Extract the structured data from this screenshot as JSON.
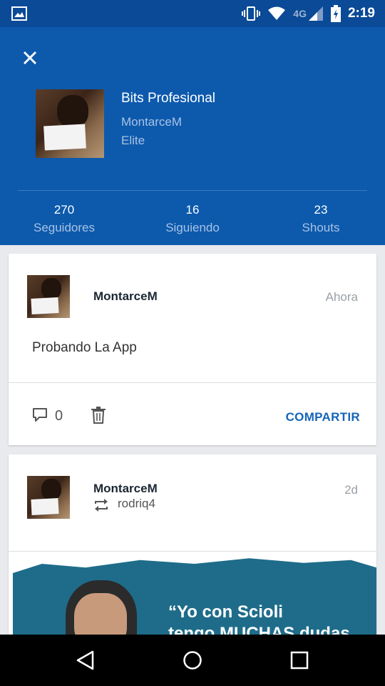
{
  "status_bar": {
    "network": "4G",
    "time": "2:19"
  },
  "profile": {
    "display_name": "Bits Profesional",
    "username": "MontarceM",
    "level": "Elite",
    "stats": [
      {
        "value": "270",
        "label": "Seguidores"
      },
      {
        "value": "16",
        "label": "Siguiendo"
      },
      {
        "value": "23",
        "label": "Shouts"
      }
    ]
  },
  "posts": [
    {
      "author": "MontarceM",
      "time": "Ahora",
      "text": "Probando La App",
      "comment_count": "0",
      "share_label": "COMPARTIR"
    },
    {
      "author": "MontarceM",
      "time": "2d",
      "reposted_from": "rodriq4",
      "image_quote_line1": "“Yo con Scioli",
      "image_quote_line2": "tengo MUCHAS dudas"
    }
  ],
  "colors": {
    "header_bg": "#0d5aad",
    "status_bar_bg": "#0a4a97",
    "accent": "#1565b8"
  }
}
